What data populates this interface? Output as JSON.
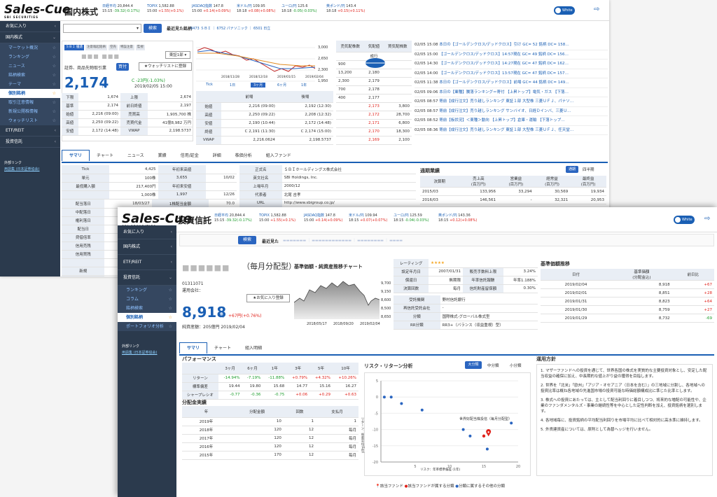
{
  "win1": {
    "logo": "Sales-Cue",
    "logo_sub": "SBI SECURITIES",
    "page_title": "国内株式",
    "tickers": [
      {
        "name": "日経平均",
        "val": "20,844.4",
        "time": "15:15",
        "chg": "-39.32(-0.17%)"
      },
      {
        "name": "TOPIX",
        "val": "1,582.88",
        "time": "15:00",
        "chg": "+1.55(+0.1%)"
      },
      {
        "name": "JASDAQ指数",
        "val": "147.8",
        "time": "15:00",
        "chg": "+0.14(+0.09%)"
      },
      {
        "name": "米ドル/円",
        "val": "109.95",
        "time": "18:18",
        "chg": "+0.08(+0.08%)"
      },
      {
        "name": "ユーロ/円",
        "val": "125.6",
        "time": "18:18",
        "chg": "-0.05(-0.03%)"
      },
      {
        "name": "英ポンド/円",
        "val": "143.4",
        "time": "18:18",
        "chg": "+0.15(+0.11%)"
      }
    ],
    "toggle": "White",
    "sidebar": {
      "fav": "お気に入り",
      "domestic": "国内株式",
      "subs": [
        "マーケット概況",
        "ランキング",
        "ニュース",
        "銘柄検索",
        "テーマ",
        "個別銘柄",
        "取引注意情報",
        "新規公開株情報",
        "ウォッチリスト"
      ],
      "etf": "ETF/REIT",
      "fund": "投資信託",
      "ext_title": "外部リンク",
      "ext_link": "用語集 (日本証券協会)"
    },
    "search_btn": "検索",
    "recent_label": "最近見た銘柄",
    "recent_items": "8473 ＳＢＩ ｜ 6752 パナソニック ｜ 6501 日立",
    "badges": [
      "ＳＢＩ 優遇",
      "注意喚起銘柄",
      "空売",
      "特設注意",
      "監視"
    ],
    "market_sel": "東証1部 ▾",
    "sector": "証券、商品先物取引業",
    "buy_btn": "買付",
    "watch_btn": "★ウォッチリストに登録",
    "price": "2,174",
    "price_unit": "円",
    "price_chg": "C  -23円(-1.03%)",
    "price_time": "2019/02/05 15:00",
    "detail_rows": [
      [
        "下限",
        "1,674",
        "上限",
        "2,674"
      ],
      [
        "基準",
        "2,174",
        "前日終値",
        "2,197"
      ],
      [
        "始値",
        "2,216 (09:00)",
        "売買高",
        "1,905,700 株"
      ],
      [
        "高値",
        "2,250 (09:22)",
        "売買代金",
        "41億8,982 万円"
      ],
      [
        "安値",
        "2,172 (14:48)",
        "VWAP",
        "2,198.5737"
      ]
    ],
    "chart_axis": [
      "3,000",
      "2,650",
      "2,300",
      "1,950"
    ],
    "chart_dates": [
      "2018/11/28",
      "2018/12/18",
      "2019/01/15",
      "2019/02/04"
    ],
    "chart_tabs": [
      "Tick",
      "1日",
      "3ヶ月",
      "6ヶ月",
      "1年"
    ],
    "session_head": [
      "",
      "前場",
      "後場"
    ],
    "session_rows": [
      [
        "始値",
        "2,216 (09:00)",
        "2,192 (12:30)"
      ],
      [
        "高値",
        "2,250 (09:22)",
        "2,208 (12:32)"
      ],
      [
        "安値",
        "2,190 (10:44)",
        "2,172 (14:48)"
      ],
      [
        "終値",
        "C 2,191 (11:30)",
        "C 2,174 (15:00)"
      ],
      [
        "VWAP",
        "2,216.0624",
        "2,198.5737"
      ]
    ],
    "board_head": [
      "売気配株数",
      "気配値",
      "買気配株数"
    ],
    "board_rows": [
      [
        "",
        "成行",
        ""
      ],
      [
        "900",
        "2,181",
        ""
      ],
      [
        "13,200",
        "2,180",
        ""
      ],
      [
        "2,300",
        "2,179",
        ""
      ],
      [
        "700",
        "2,178",
        ""
      ],
      [
        "400",
        "2,177",
        ""
      ],
      [
        "",
        "2,173",
        "3,800"
      ],
      [
        "",
        "2,172",
        "28,700"
      ],
      [
        "",
        "2,171",
        "6,800"
      ],
      [
        "",
        "2,170",
        "18,300"
      ],
      [
        "",
        "2,169",
        "2,100"
      ]
    ],
    "news": [
      [
        "02/05 15:08",
        "本日の【ゴールデンクロス/デッドクロス】引け  GC= 52 銘柄  DC= 158…"
      ],
      [
        "02/05 15:00",
        "【ゴールデンクロス/デッドクロス】14:57現在  GC= 49 銘柄  DC= 156…"
      ],
      [
        "02/05 14:30",
        "【ゴールデンクロス/デッドクロス】14:27現在  GC= 47 銘柄  DC= 162…"
      ],
      [
        "02/05 14:00",
        "【ゴールデンクロス/デッドクロス】13:57現在  GC= 47 銘柄  DC= 157…"
      ],
      [
        "02/05 11:38",
        "本日の【ゴールデンクロス/デッドクロス】前場  GC= 44 銘柄  DC= 149…"
      ],
      [
        "02/05 09:06",
        "本日の【業種】騰落ランキング＝寄付  【上昇トップ】電気・ガス  【下落…"
      ],
      [
        "02/05 08:57",
        "寄前【成行注文】売り越しランキング 東証１部 大型株  三菱ＵＦＪ、パナソ…"
      ],
      [
        "02/05 08:57",
        "寄前【成行注文】売り越しランキング  サンバイオ、日経Ｄインバ、三菱Ｕ…"
      ],
      [
        "02/05 08:52",
        "寄前【板状況】＜東種＞動向  【上昇トップ】倉庫・運輸  【下落トップ…"
      ],
      [
        "02/05 08:36",
        "寄前【成行注文】売り越しランキング 東証１部 大型株  三菱ＵＦＪ、任天堂…"
      ]
    ],
    "tabs": [
      "サマリ",
      "チャート",
      "ニュース",
      "業績",
      "信用/証金",
      "詳細",
      "株価分析",
      "組入ファンド"
    ],
    "sum_rows": [
      [
        "Tick",
        "4,425",
        "年初来高値",
        ""
      ],
      [
        "単元",
        "100株",
        "3,655",
        "10/02"
      ],
      [
        "最低購入額",
        "217,400円",
        "年初来安値",
        ""
      ],
      [
        "",
        "1,000株",
        "1,997",
        "12/26"
      ]
    ],
    "sum_rows2": [
      [
        "配当落日",
        "18/03/27",
        "1株配当金額",
        "70.0"
      ],
      [
        "中配落日",
        "",
        "PBR",
        "1.12"
      ],
      [
        "権利落日",
        "",
        "",
        ""
      ],
      [
        "配当日",
        "",
        "",
        ""
      ],
      [
        "貸借倍率",
        "",
        "",
        ""
      ],
      [
        "信用売残",
        "",
        "",
        ""
      ],
      [
        "信用買残",
        "",
        "",
        ""
      ],
      [
        "",
        "",
        "",
        ""
      ],
      [
        "新規",
        "",
        "",
        ""
      ],
      [
        "返済",
        "",
        "",
        ""
      ],
      [
        "現渡",
        "",
        "",
        ""
      ]
    ],
    "company": [
      [
        "正式名",
        "ＳＢＩホールディングス株式会社"
      ],
      [
        "英文社名",
        "SBI Holdings, Inc."
      ],
      [
        "上場年月",
        "2000/12"
      ],
      [
        "代表者",
        "北尾  吉孝"
      ],
      [
        "URL",
        "http://www.sbigroup.co.jp/"
      ]
    ],
    "perf_title": "通期業績",
    "perf_tabs": [
      "通期",
      "四半期"
    ],
    "perf_head": [
      "決算期",
      "売上高\n(百万円)",
      "営業益\n(百万円)",
      "経常益\n(百万円)",
      "最終益\n(百万円)"
    ],
    "perf_rows": [
      [
        "2015/03",
        "133,956",
        "33,294",
        "30,569",
        "19,934"
      ],
      [
        "2016/03",
        "146,561",
        "-",
        "32,321",
        "20,953"
      ]
    ]
  },
  "win2": {
    "logo": "Sales-Cue",
    "logo_sub": "SBI SECURITIES",
    "page_title": "投資信託",
    "tickers": [
      {
        "name": "日経平均",
        "val": "20,844.4",
        "time": "15:15",
        "chg": "-39.32(-0.17%)"
      },
      {
        "name": "TOPIX",
        "val": "1,582.88",
        "time": "15:00",
        "chg": "+1.55(+0.1%)"
      },
      {
        "name": "JASDAQ指数",
        "val": "147.8",
        "time": "15:00",
        "chg": "+0.14(+0.09%)"
      },
      {
        "name": "米ドル/円",
        "val": "109.94",
        "time": "18:15",
        "chg": "+0.07(+0.07%)"
      },
      {
        "name": "ユーロ/円",
        "val": "125.59",
        "time": "18:15",
        "chg": "-0.04(-0.03%)"
      },
      {
        "name": "英ポンド/円",
        "val": "143.36",
        "time": "18:15",
        "chg": "+0.12(+0.08%)"
      }
    ],
    "toggle": "White",
    "sidebar": {
      "fav": "お気に入り",
      "domestic": "国内株式",
      "etf": "ETF/REIT",
      "fund": "投資信託",
      "subs": [
        "ランキング",
        "コラム",
        "銘柄検索",
        "個別銘柄",
        "ポートフォリオ分析"
      ],
      "ext_title": "外部リンク",
      "ext_link": "用語集 (日本証券協会)"
    },
    "search_btn": "検索",
    "recent_label": "最近見た",
    "fund_name": "（毎月分配型）",
    "fund_code": "01311071",
    "fund_company": "運用会社：",
    "fav_btn": "★お気に入り登録",
    "nav": "8,918",
    "nav_unit": "円",
    "nav_chg": "+67円(+0.76%)",
    "nav_total": "純資産額：205億円  2019/02/04",
    "chart_title": "基準価額・純資産推移チャート",
    "chart_axis": [
      "9,700",
      "9,150",
      "8,600",
      "8,500",
      "8,650"
    ],
    "chart_dates": [
      "2018/05/17",
      "2018/09/20",
      "2019/02/04"
    ],
    "rating_label": "レーティング",
    "rating": "★★★★",
    "info_rows": [
      [
        "設定年月日",
        "2007/01/31",
        "販売手数料上限",
        "3.24%"
      ],
      [
        "償還日",
        "無期限",
        "年率信託報酬",
        "年率1.188%"
      ],
      [
        "決算回数",
        "毎月",
        "信託財産留保額",
        "0.30%"
      ]
    ],
    "info_rows2": [
      [
        "受託機関",
        "野村信託銀行"
      ],
      [
        "再信託受託会社",
        "-"
      ],
      [
        "分類",
        "国際株式-グローバル株式型"
      ],
      [
        "RR分類",
        "RR3+（バランス（収益重視）型）"
      ]
    ],
    "hist_title": "基準価額推移",
    "hist_head": [
      "日付",
      "基準価額\n(分配金込)",
      "前日比"
    ],
    "hist_rows": [
      [
        "2019/02/04",
        "8,918",
        "+67"
      ],
      [
        "2019/02/01",
        "8,851",
        "+28"
      ],
      [
        "2019/01/31",
        "8,823",
        "+64"
      ],
      [
        "2019/01/30",
        "8,759",
        "+27"
      ],
      [
        "2019/01/29",
        "8,732",
        "-69"
      ]
    ],
    "tabs": [
      "サマリ",
      "チャート",
      "組入明細"
    ],
    "perf_title": "パフォーマンス",
    "perf_head": [
      "",
      "3ヶ月",
      "6ヶ月",
      "1年",
      "3年",
      "5年",
      "10年"
    ],
    "perf_rows": [
      [
        "リターン",
        "-14.94%",
        "-7.19%",
        "-11.88%",
        "+0.79%",
        "+4.32%",
        "+10.26%"
      ],
      [
        "標準偏差",
        "19.44",
        "19.80",
        "15.68",
        "14.77",
        "15.16",
        "16.27"
      ],
      [
        "シャープレシオ",
        "-0.77",
        "-0.36",
        "-0.75",
        "+0.06",
        "+0.29",
        "+0.63"
      ]
    ],
    "div_title": "分配金実績",
    "div_head": [
      "年",
      "分配金額",
      "回数",
      "支払月"
    ],
    "div_rows": [
      [
        "2019年",
        "10",
        "1",
        "1"
      ],
      [
        "2018年",
        "120",
        "12",
        "毎月"
      ],
      [
        "2017年",
        "120",
        "12",
        "毎月"
      ],
      [
        "2016年",
        "120",
        "12",
        "毎月"
      ],
      [
        "2015年",
        "170",
        "12",
        "毎月"
      ]
    ],
    "risk_title": "リスク・リターン分析",
    "risk_tabs": [
      "大分類",
      "中分類",
      "小分類"
    ],
    "risk_ylabel": "リターン：年率平均(1年)",
    "risk_xlabel": "リスク：年率標準偏差 (1年)",
    "risk_annot": "世界好配当株投信（毎月分配型）",
    "risk_legend": [
      "該当ファンド",
      "該当ファンドが属する分類",
      "分類に属するその他の分類"
    ],
    "policy_title": "運用方針",
    "policy": [
      "1. マザーファンドへの投資を通じて、世界各国の株式を実質的な主要投資対象とし、安定した配当収益の確保に加え、中長期的な値上がり益の獲得を目指します。",
      "2. 世界を「北米」「欧州」「アジア・オセアニア（日本を含む）」の三地域に分割し、各地域への投資比率は概ね各地域の先進国市場の投資可能な時価総額構成比に準じた比率とします。",
      "3. 株式への投資にあたっては、主として配当利回りに着目しつつ、将来的な増配の可能性や、企業のファンダメンタルズ・事業の継続性等を中心とした定性判断を加え、投資銘柄を選別します。",
      "4. 各地域毎に、投資銘柄の平均配当利回りを市場平均に比べて相対的に高水準に維持します。",
      "5. 外貨建資産については、原則として為替ヘッジを行いません。"
    ]
  },
  "chart_data": [
    {
      "type": "scatter",
      "title": "リスク・リターン分析",
      "xlabel": "リスク：年率標準偏差 (1年)",
      "ylabel": "リターン：年率平均(1年)",
      "xlim": [
        0,
        20
      ],
      "ylim": [
        -20,
        5
      ],
      "series": [
        {
          "name": "分類に属するその他の分類",
          "points": [
            [
              0.5,
              0
            ],
            [
              1.5,
              0
            ],
            [
              3,
              -2
            ],
            [
              6,
              -4
            ],
            [
              12,
              -10
            ],
            [
              13,
              -12
            ],
            [
              15.5,
              -16
            ],
            [
              19,
              -8
            ]
          ]
        },
        {
          "name": "該当ファンドが属する分類",
          "points": [
            [
              15,
              -12
            ]
          ]
        },
        {
          "name": "該当ファンド",
          "points": [
            [
              15.68,
              -11.88
            ]
          ]
        }
      ]
    }
  ]
}
